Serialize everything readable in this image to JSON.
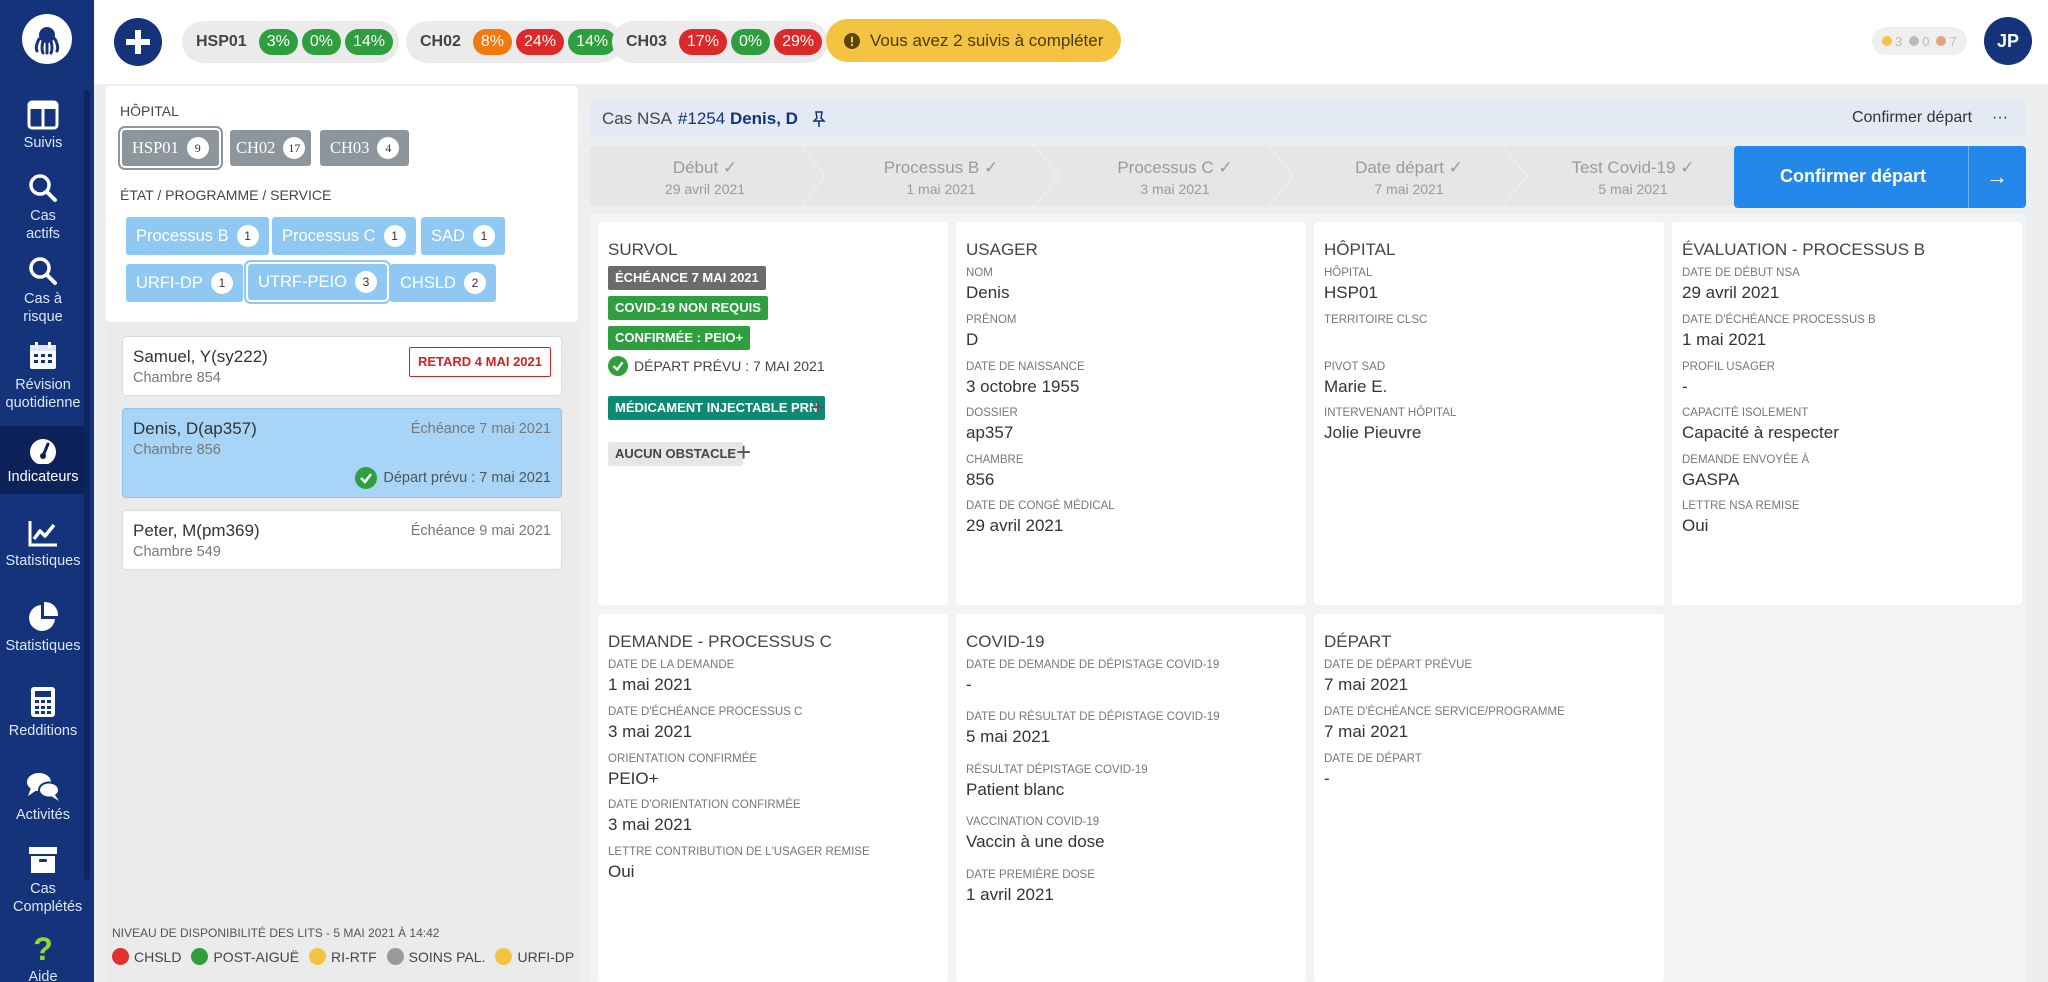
{
  "nav": {
    "items": [
      {
        "label": "Suivis",
        "icon": "columns-icon"
      },
      {
        "label": "Cas actifs",
        "icon": "search-icon"
      },
      {
        "label": "Cas à risque",
        "icon": "search-icon"
      },
      {
        "label": "Révision quotidienne",
        "icon": "calendar-icon"
      },
      {
        "label": "Indicateurs",
        "icon": "gauge-icon"
      },
      {
        "label": "Statistiques",
        "icon": "line-chart-icon"
      },
      {
        "label": "Statistiques",
        "icon": "pie-chart-icon"
      },
      {
        "label": "Redditions",
        "icon": "calculator-icon"
      },
      {
        "label": "Activités",
        "icon": "chat-icon"
      },
      {
        "label": "Cas Complétés",
        "icon": "archive-icon"
      },
      {
        "label": "Aide",
        "icon": "question-icon"
      }
    ]
  },
  "topbar": {
    "hospitals": [
      {
        "name": "HSP01",
        "pcts": [
          {
            "v": "3%",
            "c": "green"
          },
          {
            "v": "0%",
            "c": "green"
          },
          {
            "v": "14%",
            "c": "green"
          }
        ]
      },
      {
        "name": "CH02",
        "pcts": [
          {
            "v": "8%",
            "c": "orange"
          },
          {
            "v": "24%",
            "c": "red"
          },
          {
            "v": "14%",
            "c": "green"
          }
        ]
      },
      {
        "name": "CH03",
        "pcts": [
          {
            "v": "17%",
            "c": "red"
          },
          {
            "v": "0%",
            "c": "green"
          },
          {
            "v": "29%",
            "c": "red"
          }
        ]
      }
    ],
    "alert": "Vous avez 2 suivis à compléter",
    "counters": [
      "3",
      "0",
      "7"
    ],
    "avatar": "JP"
  },
  "filters": {
    "hospital_title": "HÔPITAL",
    "hospitals": [
      {
        "label": "HSP01",
        "count": "9"
      },
      {
        "label": "CH02",
        "count": "17"
      },
      {
        "label": "CH03",
        "count": "4"
      }
    ],
    "service_title": "ÉTAT / PROGRAMME / SERVICE",
    "services": [
      {
        "label": "Processus B",
        "count": "1"
      },
      {
        "label": "Processus C",
        "count": "1"
      },
      {
        "label": "SAD",
        "count": "1"
      },
      {
        "label": "URFI-DP",
        "count": "1"
      },
      {
        "label": "UTRF-PEIO",
        "count": "3"
      },
      {
        "label": "CHSLD",
        "count": "2"
      }
    ]
  },
  "cases": [
    {
      "name": "Samuel, Y(sy222)",
      "room": "Chambre 854",
      "badge": "RETARD 4 MAI 2021"
    },
    {
      "name": "Denis, D(ap357)",
      "room": "Chambre 856",
      "due": "Échéance 7 mai 2021",
      "planned": "Départ prévu : 7 mai 2021"
    },
    {
      "name": "Peter, M(pm369)",
      "room": "Chambre 549",
      "due": "Échéance 9 mai 2021"
    }
  ],
  "legend": {
    "title": "NIVEAU DE DISPONIBILITÉ DES LITS - 5 MAI 2021 À 14:42",
    "items": [
      {
        "label": "CHSLD",
        "color": "#e03131"
      },
      {
        "label": "POST-AIGUË",
        "color": "#2e9e3e"
      },
      {
        "label": "RI-RTF",
        "color": "#f5c342"
      },
      {
        "label": "SOINS PAL.",
        "color": "#9a9a9a"
      },
      {
        "label": "URFI-DP",
        "color": "#f5c342"
      }
    ]
  },
  "case_header": {
    "prefix": "Cas NSA",
    "id": "#1254",
    "name": "Denis, D",
    "confirm_link": "Confirmer départ",
    "more": "···"
  },
  "steps": [
    {
      "label": "Début",
      "date": "29 avril 2021"
    },
    {
      "label": "Processus B",
      "date": "1 mai 2021"
    },
    {
      "label": "Processus C",
      "date": "3 mai 2021"
    },
    {
      "label": "Date départ",
      "date": "7 mai 2021"
    },
    {
      "label": "Test Covid-19",
      "date": "5 mai 2021"
    }
  ],
  "confirm_button": "Confirmer départ",
  "survol": {
    "title": "SURVOL",
    "tag1": "ÉCHÉANCE 7 MAI 2021",
    "tag2": "COVID-19 NON REQUIS",
    "tag3": "CONFIRMÉE : PEIO+",
    "planned": "DÉPART PRÉVU : 7 MAI 2021",
    "tag4": "MÉDICAMENT INJECTABLE PRN",
    "tag5": "AUCUN OBSTACLE"
  },
  "usager": {
    "title": "USAGER",
    "fields": [
      {
        "label": "NOM",
        "value": "Denis"
      },
      {
        "label": "PRÉNOM",
        "value": "D"
      },
      {
        "label": "DATE DE NAISSANCE",
        "value": "3 octobre 1955"
      },
      {
        "label": "DOSSIER",
        "value": "ap357"
      },
      {
        "label": "CHAMBRE",
        "value": "856"
      },
      {
        "label": "DATE DE CONGÉ MÉDICAL",
        "value": "29 avril 2021"
      }
    ]
  },
  "hopital": {
    "title": "HÔPITAL",
    "fields": [
      {
        "label": "HÔPITAL",
        "value": "HSP01"
      },
      {
        "label": "TERRITOIRE CLSC",
        "value": ""
      },
      {
        "label": "PIVOT SAD",
        "value": "Marie E."
      },
      {
        "label": "INTERVENANT HÔPITAL",
        "value": "Jolie Pieuvre"
      }
    ]
  },
  "evaluation": {
    "title": "ÉVALUATION - PROCESSUS B",
    "fields": [
      {
        "label": "DATE DE DÉBUT NSA",
        "value": "29 avril 2021"
      },
      {
        "label": "DATE D'ÉCHÉANCE PROCESSUS B",
        "value": "1 mai 2021"
      },
      {
        "label": "PROFIL USAGER",
        "value": "-"
      },
      {
        "label": "CAPACITÉ ISOLEMENT",
        "value": "Capacité à respecter"
      },
      {
        "label": "DEMANDE ENVOYÉE À",
        "value": "GASPA"
      },
      {
        "label": "LETTRE NSA REMISE",
        "value": "Oui"
      }
    ]
  },
  "demande": {
    "title": "DEMANDE - PROCESSUS C",
    "fields": [
      {
        "label": "DATE DE LA DEMANDE",
        "value": "1 mai 2021"
      },
      {
        "label": "DATE D'ÉCHÉANCE PROCESSUS C",
        "value": "3 mai 2021"
      },
      {
        "label": "ORIENTATION CONFIRMÉE",
        "value": "PEIO+"
      },
      {
        "label": "DATE D'ORIENTATION CONFIRMÉE",
        "value": "3 mai 2021"
      },
      {
        "label": "LETTRE CONTRIBUTION DE L'USAGER REMISE",
        "value": "Oui"
      }
    ]
  },
  "covid": {
    "title": "COVID-19",
    "fields": [
      {
        "label": "DATE DE DEMANDE DE DÉPISTAGE COVID-19",
        "value": "-"
      },
      {
        "label": "DATE DU RÉSULTAT DE DÉPISTAGE COVID-19",
        "value": "5 mai 2021"
      },
      {
        "label": "RÉSULTAT DÉPISTAGE COVID-19",
        "value": "Patient blanc"
      },
      {
        "label": "VACCINATION COVID-19",
        "value": "Vaccin à une dose"
      },
      {
        "label": "DATE PREMIÈRE DOSE",
        "value": "1 avril 2021"
      }
    ]
  },
  "depart": {
    "title": "DÉPART",
    "fields": [
      {
        "label": "DATE DE DÉPART PRÉVUE",
        "value": "7 mai 2021"
      },
      {
        "label": "DATE D'ÉCHÉANCE SERVICE/PROGRAMME",
        "value": "7 mai 2021"
      },
      {
        "label": "DATE DE DÉPART",
        "value": "-"
      }
    ]
  }
}
